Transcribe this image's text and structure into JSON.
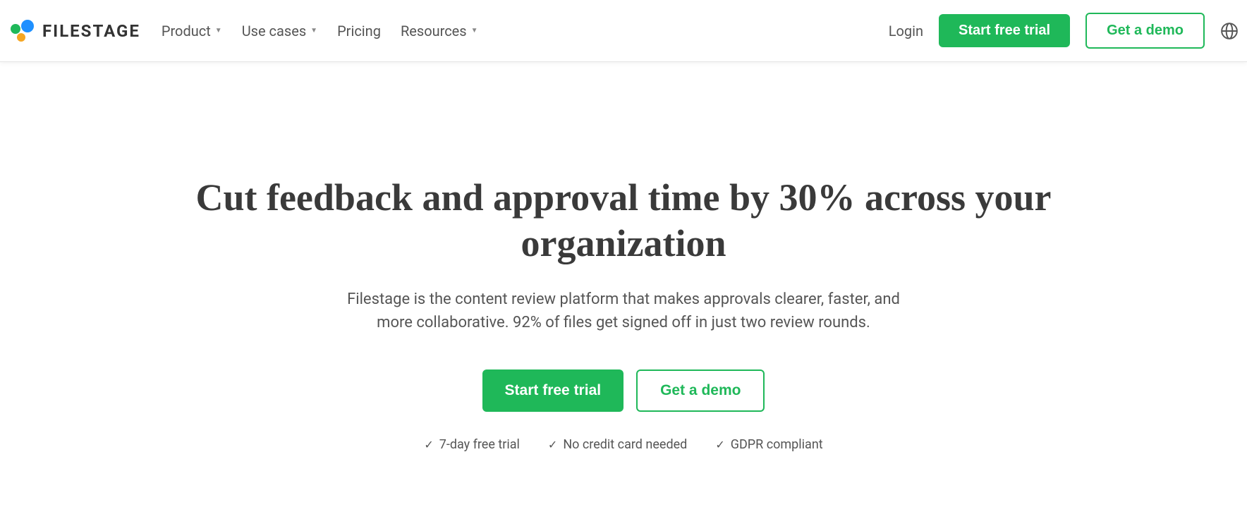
{
  "brand": {
    "name": "FILESTAGE"
  },
  "nav": {
    "items": [
      {
        "label": "Product",
        "has_dropdown": true
      },
      {
        "label": "Use cases",
        "has_dropdown": true
      },
      {
        "label": "Pricing",
        "has_dropdown": false
      },
      {
        "label": "Resources",
        "has_dropdown": true
      }
    ]
  },
  "header_actions": {
    "login": "Login",
    "start_trial": "Start free trial",
    "get_demo": "Get a demo"
  },
  "hero": {
    "headline": "Cut feedback and approval time by 30% across your organization",
    "subtext": "Filestage is the content review platform that makes approvals clearer, faster, and more collaborative. 92% of files get signed off in just two review rounds.",
    "cta_primary": "Start free trial",
    "cta_secondary": "Get a demo",
    "benefits": [
      "7-day free trial",
      "No credit card needed",
      "GDPR compliant"
    ]
  }
}
